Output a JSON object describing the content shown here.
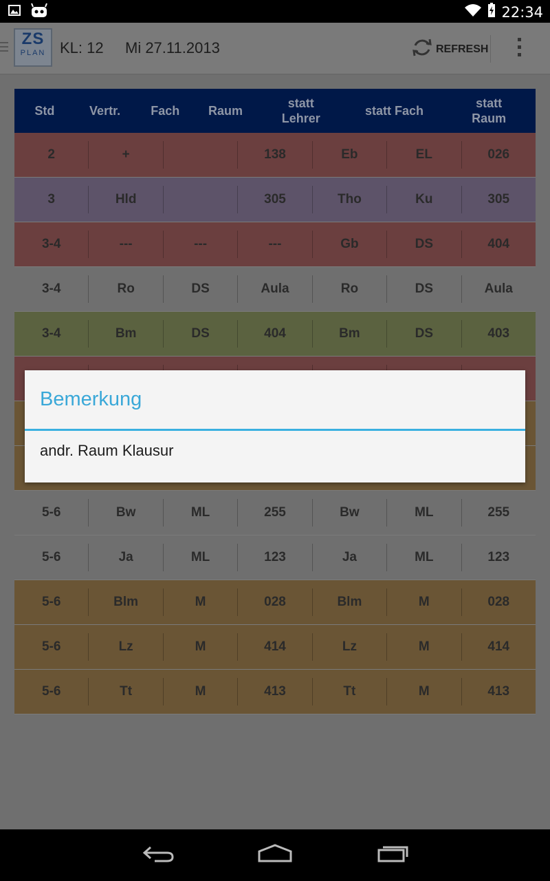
{
  "status": {
    "time": "22:34"
  },
  "app": {
    "logo_top": "ZS",
    "logo_bottom": "PLAN",
    "class_label": "KL: 12",
    "date": "Mi 27.11.2013",
    "refresh_label": "REFRESH"
  },
  "table": {
    "headers": [
      "Std",
      "Vertr.",
      "Fach",
      "Raum",
      "statt Lehrer",
      "statt Fach",
      "statt Raum"
    ],
    "rows": [
      {
        "bg": "#6b3f3f",
        "cells": [
          "2",
          "+",
          "",
          "138",
          "Eb",
          "EL",
          "026"
        ]
      },
      {
        "bg": "#5d5369",
        "cells": [
          "3",
          "Hld",
          "",
          "305",
          "Tho",
          "Ku",
          "305"
        ]
      },
      {
        "bg": "#6b3f3f",
        "cells": [
          "3-4",
          "---",
          "---",
          "---",
          "Gb",
          "DS",
          "404"
        ]
      },
      {
        "bg": "#6f6f6f",
        "cells": [
          "3-4",
          "Ro",
          "DS",
          "Aula",
          "Ro",
          "DS",
          "Aula"
        ]
      },
      {
        "bg": "#5b6240",
        "cells": [
          "3-4",
          "Bm",
          "DS",
          "404",
          "Bm",
          "DS",
          "403"
        ]
      },
      {
        "bg": "#6b3f3f",
        "cells": [
          "",
          "",
          "",
          "",
          "",
          "",
          ""
        ]
      },
      {
        "bg": "#6a5535",
        "cells": [
          "",
          "",
          "",
          "",
          "",
          "",
          ""
        ]
      },
      {
        "bg": "#6a5535",
        "cells": [
          "",
          "",
          "",
          "",
          "",
          "",
          ""
        ]
      },
      {
        "bg": "#6f6f6f",
        "cells": [
          "5-6",
          "Bw",
          "ML",
          "255",
          "Bw",
          "ML",
          "255"
        ]
      },
      {
        "bg": "#6f6f6f",
        "cells": [
          "5-6",
          "Ja",
          "ML",
          "123",
          "Ja",
          "ML",
          "123"
        ]
      },
      {
        "bg": "#6a5535",
        "cells": [
          "5-6",
          "Blm",
          "M",
          "028",
          "Blm",
          "M",
          "028"
        ]
      },
      {
        "bg": "#6a5535",
        "cells": [
          "5-6",
          "Lz",
          "M",
          "414",
          "Lz",
          "M",
          "414"
        ]
      },
      {
        "bg": "#6a5535",
        "cells": [
          "5-6",
          "Tt",
          "M",
          "413",
          "Tt",
          "M",
          "413"
        ]
      }
    ]
  },
  "dialog": {
    "title": "Bemerkung",
    "message": "andr. Raum Klausur"
  },
  "colors": {
    "accent": "#3ab0e0",
    "header_bg": "#001848"
  }
}
